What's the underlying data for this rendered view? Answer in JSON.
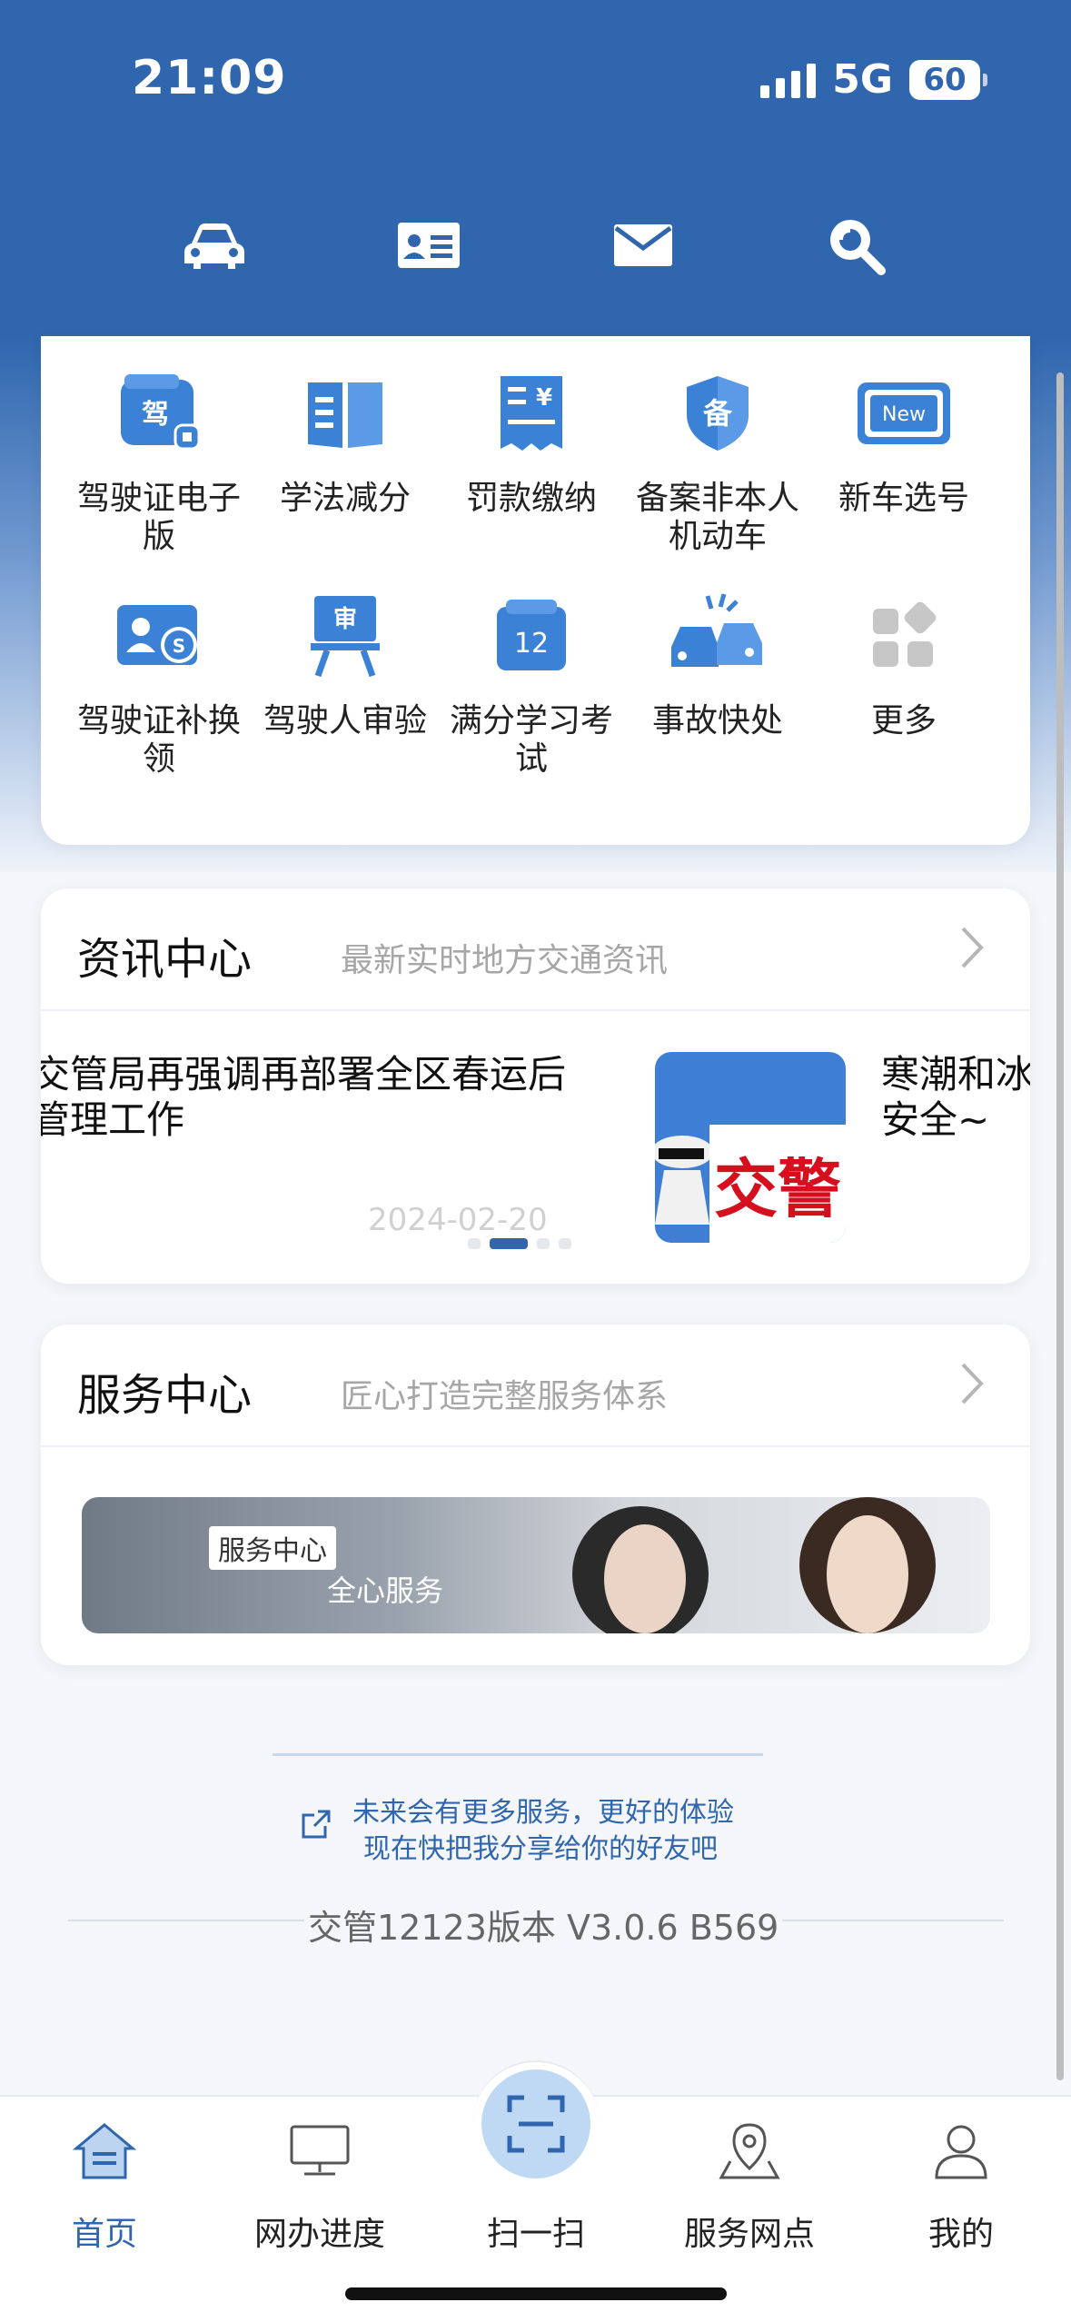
{
  "status_bar": {
    "time": "21:09",
    "network": "5G",
    "battery": "60"
  },
  "header": {
    "icons": [
      "car-icon",
      "id-card-icon",
      "mail-icon",
      "search-icon"
    ]
  },
  "grid": {
    "items": [
      {
        "label": "驾驶证电子版",
        "icon": "license-icon"
      },
      {
        "label": "学法减分",
        "icon": "book-icon"
      },
      {
        "label": "罚款缴纳",
        "icon": "fine-receipt-icon"
      },
      {
        "label": "备案非本人机动车",
        "icon": "shield-icon"
      },
      {
        "label": "新车选号",
        "icon": "new-plate-icon"
      },
      {
        "label": "驾驶证补换领",
        "icon": "license-renew-icon"
      },
      {
        "label": "驾驶人审验",
        "icon": "review-icon"
      },
      {
        "label": "满分学习考试",
        "icon": "calendar-12-icon"
      },
      {
        "label": "事故快处",
        "icon": "accident-icon"
      },
      {
        "label": "更多",
        "icon": "more-grid-icon"
      }
    ]
  },
  "news": {
    "title": "资讯中心",
    "subtitle": "最新实时地方交通资讯",
    "headline_line1": "交管局再强调再部署全区春运后",
    "headline_line2": "管理工作",
    "date": "2024-02-20",
    "image_badge": "交警",
    "next_line1": "寒潮和冰",
    "next_line2": "安全~"
  },
  "service": {
    "title": "服务中心",
    "subtitle": "匠心打造完整服务体系",
    "banner_tag": "服务中心",
    "banner_text": "全心服务"
  },
  "share": {
    "line1": "未来会有更多服务，更好的体验",
    "line2": "现在快把我分享给你的好友吧"
  },
  "version": "交管12123版本 V3.0.6 B569",
  "tabbar": {
    "items": [
      {
        "label": "首页",
        "icon": "home-icon"
      },
      {
        "label": "网办进度",
        "icon": "monitor-icon"
      },
      {
        "label": "扫一扫",
        "icon": "scan-icon"
      },
      {
        "label": "服务网点",
        "icon": "location-icon"
      },
      {
        "label": "我的",
        "icon": "user-icon"
      }
    ]
  },
  "colors": {
    "brand": "#2f66ae",
    "accent_red": "#d60f1f"
  }
}
